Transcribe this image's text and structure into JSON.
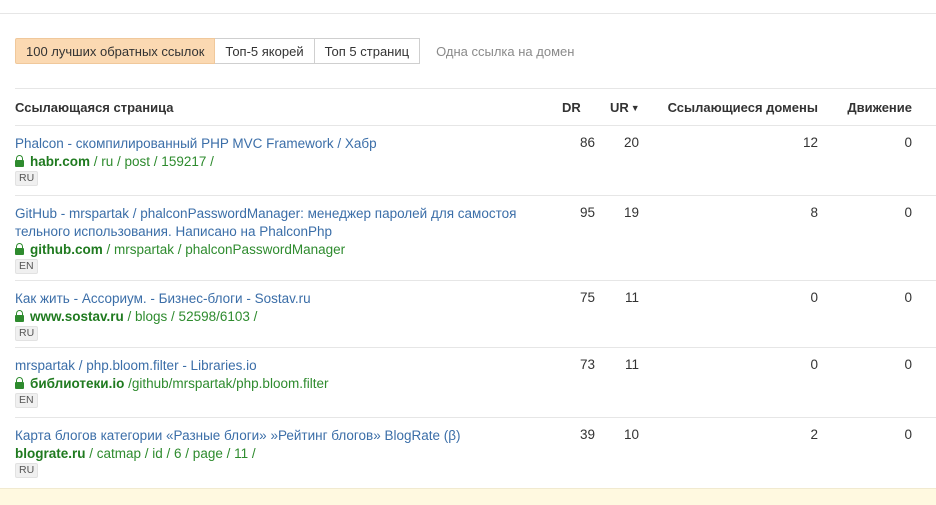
{
  "tabs": [
    {
      "label": "100 лучших обратных ссылок",
      "active": true
    },
    {
      "label": "Топ-5 якорей",
      "active": false
    },
    {
      "label": "Топ 5 страниц",
      "active": false
    }
  ],
  "tab_link": "Одна ссылка на домен",
  "columns": {
    "page": "Ссылающаяся страница",
    "dr": "DR",
    "ur": "UR",
    "ur_sort_icon": "caret-down-icon",
    "ref_domains": "Ссылающиеся домены",
    "movement": "Движение"
  },
  "rows": [
    {
      "title": "Phalcon - скомпилированный PHP MVC Framework / Хабр",
      "domain": "habr.com",
      "path": " / ru / post / 159217 /",
      "lang": "RU",
      "secure": true,
      "dr": "86",
      "ur": "20",
      "ref_domains": "12",
      "movement": "0"
    },
    {
      "title": "GitHub - mrspartak / phalconPasswordManager: менеджер паролей для самостоя тельного использования. Написано на PhalconPhp",
      "domain": "github.com",
      "path": " / mrspartak / phalconPasswordManager",
      "lang": "EN",
      "secure": true,
      "dr": "95",
      "ur": "19",
      "ref_domains": "8",
      "movement": "0"
    },
    {
      "title": "Как жить - Ассориум. - Бизнес-блоги - Sostav.ru",
      "domain": "www.sostav.ru",
      "path": " / blogs / 52598/6103 /",
      "lang": "RU",
      "secure": true,
      "dr": "75",
      "ur": "11",
      "ref_domains": "0",
      "movement": "0"
    },
    {
      "title": "mrspartak / php.bloom.filter - Libraries.io",
      "domain": "библиотеки.io",
      "path": " /github/mrspartak/php.bloom.filter",
      "lang": "EN",
      "secure": true,
      "dr": "73",
      "ur": "11",
      "ref_domains": "0",
      "movement": "0"
    },
    {
      "title": "Карта блогов категории «Разные блоги» »Рейтинг блогов» BlogRate (β)",
      "domain": "blograte.ru",
      "path": " / catmap / id / 6 / page / 11 /",
      "lang": "RU",
      "secure": false,
      "dr": "39",
      "ur": "10",
      "ref_domains": "2",
      "movement": "0"
    }
  ]
}
